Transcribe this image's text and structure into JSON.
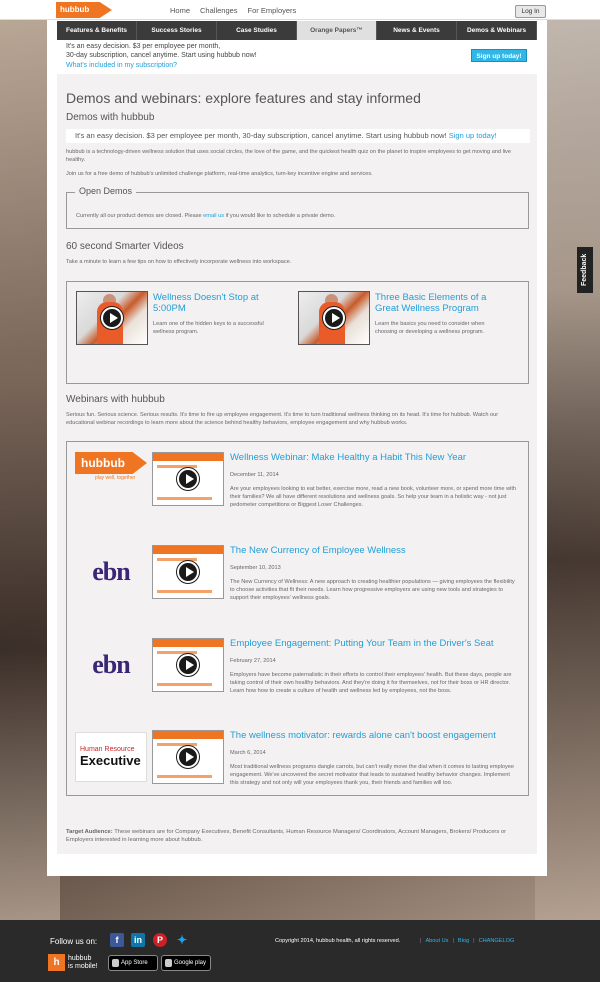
{
  "topbar": {
    "logo": "hubbub",
    "links": [
      "Home",
      "Challenges",
      "For Employers"
    ],
    "login": "Log In"
  },
  "nav": {
    "items": [
      "Features & Benefits",
      "Success Stories",
      "Case Studies",
      "Orange Papers™",
      "News & Events",
      "Demos & Webinars"
    ]
  },
  "promo": {
    "line1": "It's an easy decision. $3 per employee per month,",
    "line2": "30-day subscription, cancel anytime. Start using hubbub now!",
    "link": "What's included in my subscription?",
    "button": "Sign up today!"
  },
  "page": {
    "title": "Demos and webinars: explore features and stay informed",
    "demos_heading": "Demos with hubbub",
    "strip_text": "It's an easy decision. $3 per employee per month, 30-day subscription, cancel anytime. Start using hubbub now! ",
    "strip_link": "Sign up today!",
    "intro1": "hubbub is a technology-driven wellness solution that uses social circles, the love of the game, and the quickest health quiz on the planet to inspire employees to get moving and live healthy.",
    "intro2": "Join us for a free demo of hubbub's unlimited challenge platform, real-time analytics, turn-key incentive engine and services.",
    "open_demos": {
      "legend": "Open Demos",
      "text_before": "Currently all our product demos are closed. Please ",
      "link": "email us",
      "text_after": " if you would like to schedule a private demo."
    },
    "videos_heading": "60 second Smarter Videos",
    "videos_intro": "Take a minute to learn a few tips on how to effectively incorporate wellness into workspace.",
    "videos": [
      {
        "title": "Wellness Doesn't Stop at 5:00PM",
        "desc": "Learn one of the hidden keys to a successful wellness program."
      },
      {
        "title": "Three Basic Elements of a Great Wellness Program",
        "desc": "Learn the basics you need to consider when choosing or developing a wellness program."
      }
    ],
    "webinars_heading": "Webinars with hubbub",
    "webinars_intro": "Serious fun. Serious science. Serious results. It's time to fire up employee engagement. It's time to turn traditional wellness thinking on its head. It's time for hubbub. Watch our educational webinar recordings to learn more about the science behind healthy behaviors, employee engagement and why hubbub works.",
    "webinars": [
      {
        "brand": "hubbub",
        "brand_sub": "play well, together",
        "title": "Wellness Webinar: Make Healthy a Habit This New Year",
        "date": "December 11, 2014",
        "desc": "Are your employees looking to eat better, exercise more, read a new book, volunteer more, or spend more time with their families? We all have different resolutions and wellness goals. So help your team in a holistic way - not just pedometer competitions or Biggest Loser Challenges."
      },
      {
        "brand": "ebn",
        "title": "The New Currency of Employee Wellness",
        "date": "September 10, 2013",
        "desc": "The New Currency of Wellness: A new approach to creating healthier populations — giving employees the flexibility to choose activities that fit their needs. Learn how progressive employers are using new tools and strategies to support their employees' wellness goals."
      },
      {
        "brand": "ebn",
        "title": "Employee Engagement: Putting Your Team in the Driver's Seat",
        "date": "February 27, 2014",
        "desc": "Employers have become paternalistic in their efforts to control their employees' health. But these days, people are taking control of their own healthy behaviors. And they're doing it for themselves, not for their boss or HR director. Learn how how to create a culture of health and wellness led by employees, not the boss."
      },
      {
        "brand_a": "Human Resource",
        "brand_b": "Executive",
        "title": "The wellness motivator: rewards alone can't boost engagement",
        "date": "March 6, 2014",
        "desc": "Most traditional wellness programs dangle carrots, but can't really move the dial when it comes to lasting employee engagement. We've uncovered the secret motivator that leads to sustained healthy behavior changes. Implement this strategy and not only will your employees thank you, their friends and families will too."
      }
    ],
    "target_label": "Target Audience:",
    "target_text": " These webinars are for Company Executives, Benefit Consultants, Human Resource Managers/ Coordinators, Account Managers, Brokers/ Producers or Employers interested in learning more about hubbub."
  },
  "feedback": "Feedback",
  "footer": {
    "follow": "Follow us on:",
    "social": [
      "facebook-icon",
      "linkedin-icon",
      "pinterest-icon",
      "twitter-icon"
    ],
    "copyright": "Copyright 2014, hubbub health, all rights reserved.",
    "links": [
      "About Us",
      "Blog",
      "CHANGELOG"
    ],
    "mobile_line1": "hubbub",
    "mobile_line2": "is mobile!",
    "app_store": "App Store",
    "google_play": "Google play"
  },
  "colors": {
    "accent": "#f07522",
    "link": "#1f9fd8",
    "nav": "#3b3b3b"
  }
}
